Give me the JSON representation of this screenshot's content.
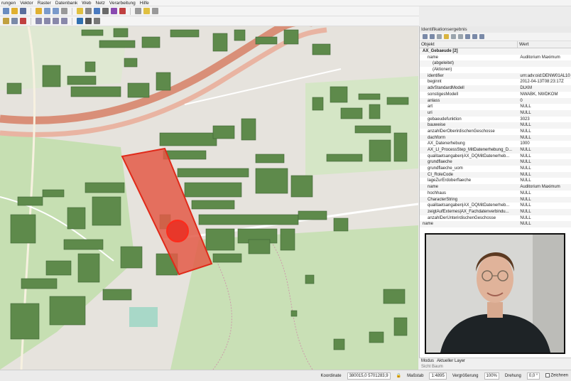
{
  "menubar": [
    "rungen",
    "Vektor",
    "Raster",
    "Datenbank",
    "Web",
    "Netz",
    "Verarbeitung",
    "Hilfe"
  ],
  "colors": {
    "building": "#5e8a4b",
    "selection": "#e02a1a",
    "road": "#e8a594",
    "forest": "#c5dfb4"
  },
  "identify": {
    "title": "Identifikationsergebnis",
    "col_object": "Objekt",
    "col_value": "Wert",
    "rows": [
      {
        "key": "AX_Gebaeude  [2]",
        "value": ""
      },
      {
        "key": "name",
        "value": "Auditorium Maximum"
      },
      {
        "key": "(abgeleitet)",
        "value": ""
      },
      {
        "key": "(Aktionen)",
        "value": ""
      },
      {
        "key": "identifier",
        "value": "urn:adv:oid:DENW01AL10"
      },
      {
        "key": "beginnt",
        "value": "2012-04-13T08:23:17Z"
      },
      {
        "key": "advStandardModell",
        "value": "DLKM"
      },
      {
        "key": "sonstigesModell",
        "value": "NWABK, NWDKOM"
      },
      {
        "key": "anlass",
        "value": "0"
      },
      {
        "key": "art",
        "value": "NULL"
      },
      {
        "key": "uri",
        "value": "NULL"
      },
      {
        "key": "gebaeudefunktion",
        "value": "3023"
      },
      {
        "key": "bauweise",
        "value": "NULL"
      },
      {
        "key": "anzahlDerOberirdischenGeschosse",
        "value": "NULL"
      },
      {
        "key": "dachform",
        "value": "NULL"
      },
      {
        "key": "AX_Datenerhebung",
        "value": "1000"
      },
      {
        "key": "AX_LI_ProcessStep_MitDatenerhebung_D...",
        "value": "NULL"
      },
      {
        "key": "qualitaetsangaben|AX_DQMitDatenerheb...",
        "value": "NULL"
      },
      {
        "key": "grundflaeche",
        "value": "NULL"
      },
      {
        "key": "grundflaeche_uom",
        "value": "NULL"
      },
      {
        "key": "CI_RoleCode",
        "value": "NULL"
      },
      {
        "key": "lageZurErdoberflaeche",
        "value": "NULL"
      },
      {
        "key": "name",
        "value": "Auditorium Maximum"
      },
      {
        "key": "hochhaus",
        "value": "NULL"
      },
      {
        "key": "CharacterString",
        "value": "NULL"
      },
      {
        "key": "qualitaetsangaben|AX_DQMitDatenerheb...",
        "value": "NULL"
      },
      {
        "key": "zeigtAufExternes|AX_Fachdatenverbindu...",
        "value": "NULL"
      },
      {
        "key": "anzahlDerUnterirdischenGeschosse",
        "value": "NULL"
      },
      {
        "key": "name",
        "value": "NULL"
      }
    ],
    "mode_label": "Modus",
    "mode_value": "Aktueller Layer",
    "view_label": "Sicht",
    "view_value": "Baum"
  },
  "status": {
    "coordinate_label": "Koordinate",
    "coordinate": "380015,0  5701283,9",
    "scale_label": "Maßstab",
    "scale": "1:4895",
    "magnify_label": "Vergrößerung",
    "magnify": "100%",
    "rotation_label": "Drehung",
    "rotation": "0,0 °",
    "render_label": "Zeichnen"
  }
}
